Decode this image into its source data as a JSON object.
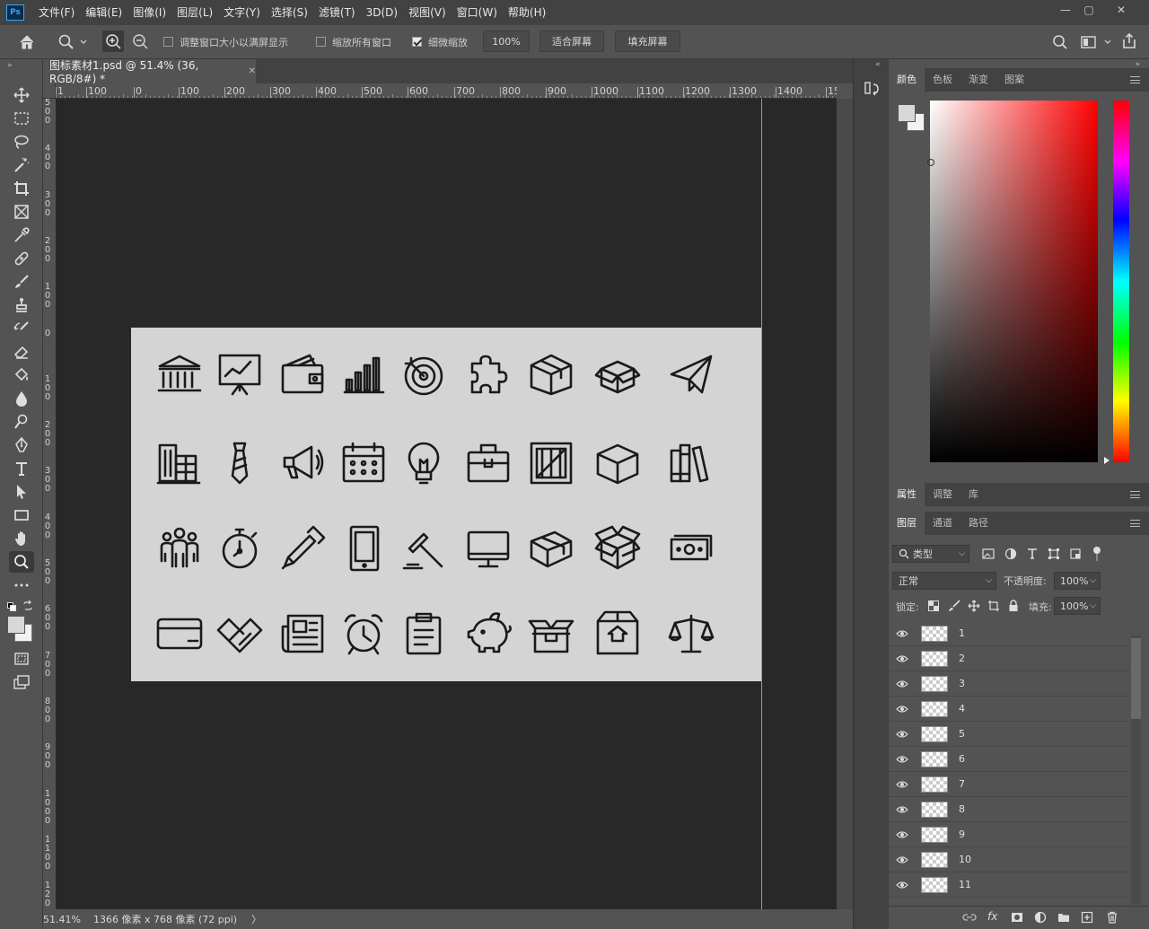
{
  "app": {
    "logo": "Ps"
  },
  "menu": [
    "文件(F)",
    "编辑(E)",
    "图像(I)",
    "图层(L)",
    "文字(Y)",
    "选择(S)",
    "滤镜(T)",
    "3D(D)",
    "视图(V)",
    "窗口(W)",
    "帮助(H)"
  ],
  "options": {
    "resize_windows": "调整窗口大小以满屏显示",
    "zoom_all": "缩放所有窗口",
    "scrubby_zoom": "细微缩放",
    "zoom_value": "100%",
    "fit_screen": "适合屏幕",
    "fill_screen": "填充屏幕"
  },
  "document": {
    "tab_title": "图标素材1.psd @ 51.4% (36, RGB/8#) *",
    "ruler_h_labels": [
      "1",
      "100",
      "0",
      "100",
      "200",
      "300",
      "400",
      "500",
      "600",
      "700",
      "800",
      "900",
      "1000",
      "1100",
      "1200",
      "1300",
      "1400",
      "15"
    ],
    "ruler_v_labels": [
      "500",
      "400",
      "300",
      "200",
      "100",
      "0",
      "100",
      "200",
      "300",
      "400",
      "500",
      "600",
      "700",
      "800",
      "900",
      "1000",
      "1100",
      "120"
    ],
    "icons": [
      "bank-icon",
      "presentation-chart-icon",
      "wallet-icon",
      "bar-chart-icon",
      "target-icon",
      "puzzle-icon",
      "box-icon",
      "open-box-icon",
      "paper-plane-icon",
      "buildings-icon",
      "tie-icon",
      "megaphone-icon",
      "calendar-icon",
      "lightbulb-icon",
      "briefcase-icon",
      "crate-icon",
      "cube-icon",
      "books-icon",
      "team-icon",
      "stopwatch-icon",
      "pen-icon",
      "tablet-icon",
      "gavel-icon",
      "monitor-icon",
      "package-icon",
      "open-package-icon",
      "money-icon",
      "credit-card-icon",
      "handshake-icon",
      "newspaper-icon",
      "alarm-clock-icon",
      "clipboard-icon",
      "piggy-bank-icon",
      "delivery-box-icon",
      "upload-box-icon",
      "scales-icon"
    ]
  },
  "status": {
    "zoom": "51.41%",
    "info": "1366 像素 x 768 像素 (72 ppi)",
    "arrow": "〉"
  },
  "color_panel": {
    "tabs": [
      "颜色",
      "色板",
      "渐变",
      "图案"
    ],
    "active": "颜色"
  },
  "properties_panel": {
    "tabs": [
      "属性",
      "调整",
      "库"
    ],
    "active": "属性"
  },
  "layers_panel": {
    "tabs": [
      "图层",
      "通道",
      "路径"
    ],
    "active": "图层",
    "filter_kind": "类型",
    "blend_mode": "正常",
    "opacity_label": "不透明度:",
    "opacity_value": "100%",
    "lock_label": "锁定:",
    "fill_label": "填充:",
    "fill_value": "100%",
    "layers": [
      "1",
      "2",
      "3",
      "4",
      "5",
      "6",
      "7",
      "8",
      "9",
      "10",
      "11"
    ]
  }
}
